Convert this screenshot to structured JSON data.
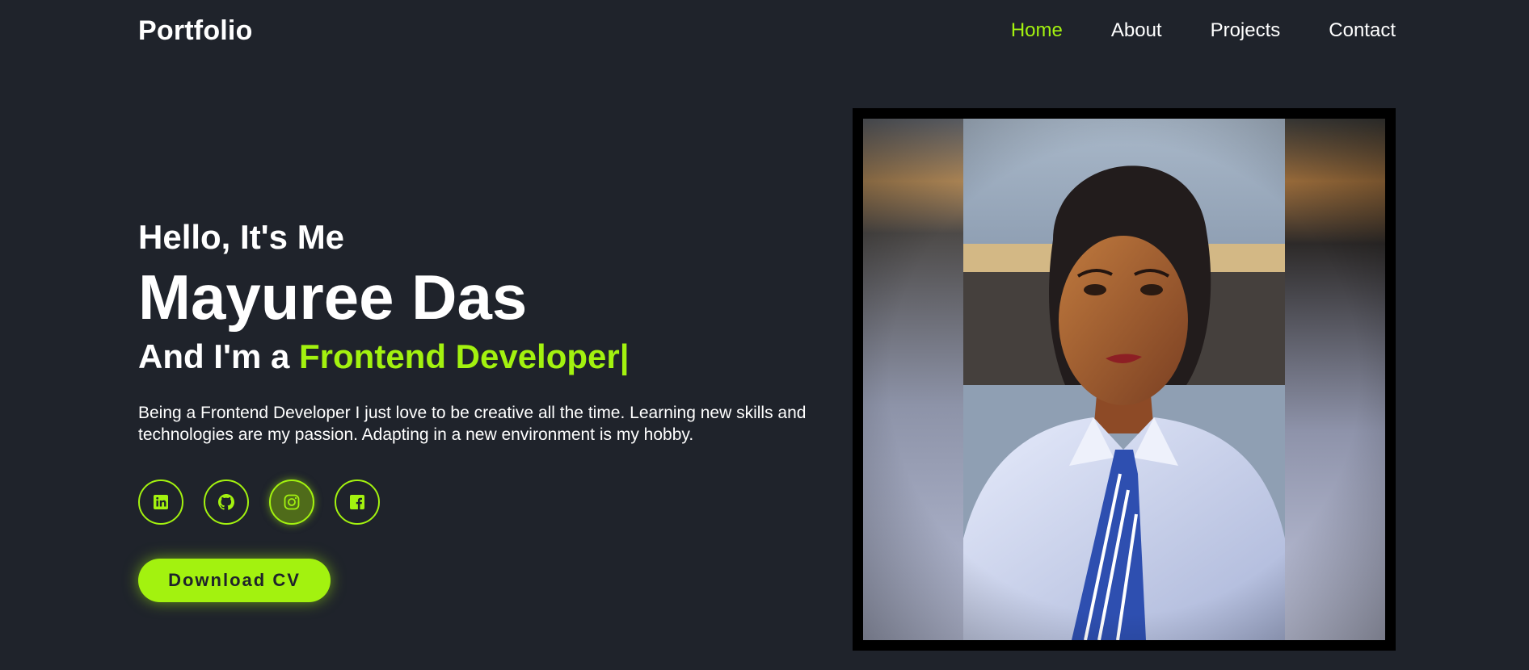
{
  "header": {
    "logo": "Portfolio",
    "nav": [
      {
        "label": "Home",
        "active": true
      },
      {
        "label": "About",
        "active": false
      },
      {
        "label": "Projects",
        "active": false
      },
      {
        "label": "Contact",
        "active": false
      }
    ]
  },
  "hero": {
    "greeting": "Hello, It's Me",
    "name": "Mayuree Das",
    "role_prefix": "And I'm a ",
    "role_highlight": "Frontend Developer|",
    "bio": "Being a Frontend Developer I just love to be creative all the time. Learning new skills and technologies are my passion. Adapting in a new environment is my hobby.",
    "cv_button": "Download CV"
  },
  "socials": [
    {
      "icon": "linkedin-icon"
    },
    {
      "icon": "github-icon"
    },
    {
      "icon": "instagram-icon"
    },
    {
      "icon": "facebook-icon"
    }
  ],
  "colors": {
    "background": "#1f232b",
    "accent": "#a3f20f",
    "text": "#ffffff"
  }
}
